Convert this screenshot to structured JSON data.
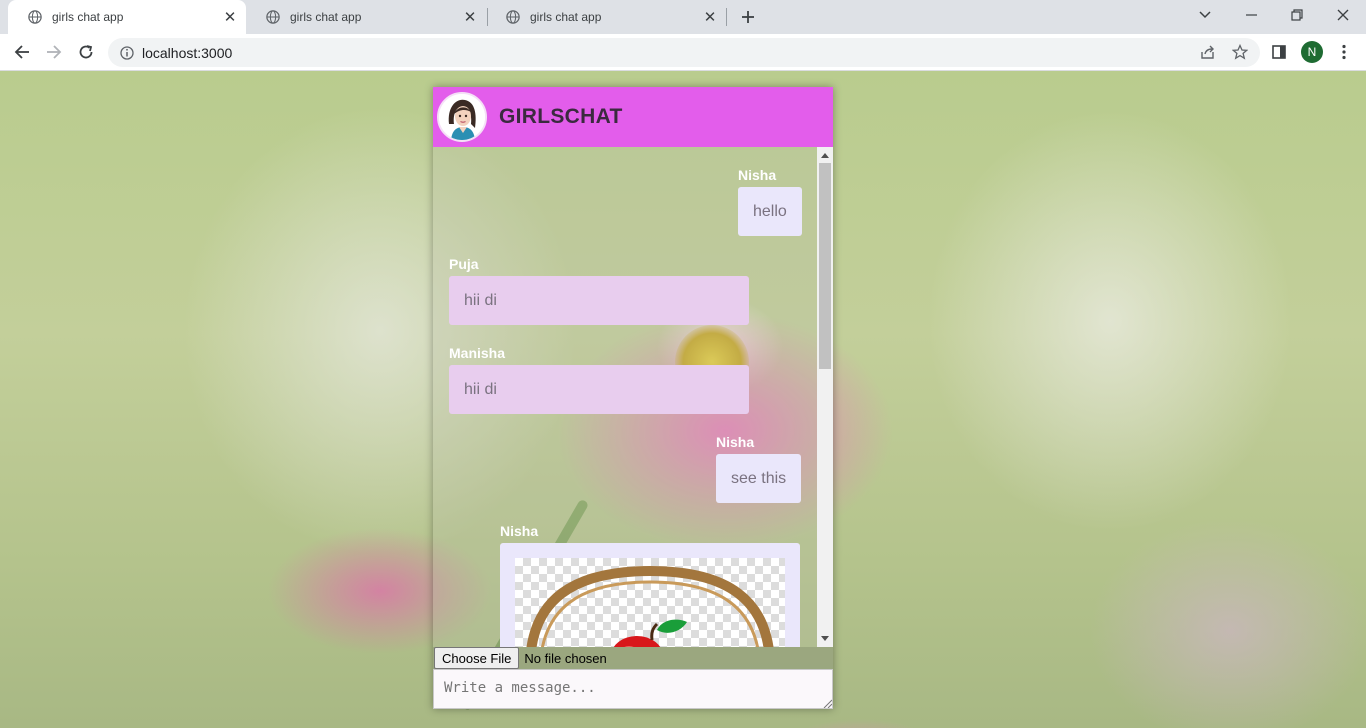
{
  "browser": {
    "tabs": [
      {
        "title": "girls chat app",
        "active": true
      },
      {
        "title": "girls chat app",
        "active": false
      },
      {
        "title": "girls chat app",
        "active": false
      }
    ],
    "url": "localhost:3000",
    "profile_initial": "N"
  },
  "chat": {
    "title": "GIRLSCHAT",
    "header_color": "#e35deb",
    "messages": [
      {
        "sender": "Nisha",
        "text": "hello",
        "side": "right"
      },
      {
        "sender": "Puja",
        "text": "hii di",
        "side": "left"
      },
      {
        "sender": "Manisha",
        "text": "hii di",
        "side": "left"
      },
      {
        "sender": "Nisha",
        "text": "see this",
        "side": "right"
      },
      {
        "sender": "Nisha",
        "type": "image",
        "image_icon": "apple-basket-image",
        "side": "right"
      }
    ],
    "file_input": {
      "button_label": "Choose File",
      "status": "No file chosen"
    },
    "message_input": {
      "placeholder": "Write a message..."
    }
  },
  "colors": {
    "incoming_bubble": "#e8cdee",
    "outgoing_bubble": "#eae7fb",
    "sender_name": "#ffffff"
  }
}
